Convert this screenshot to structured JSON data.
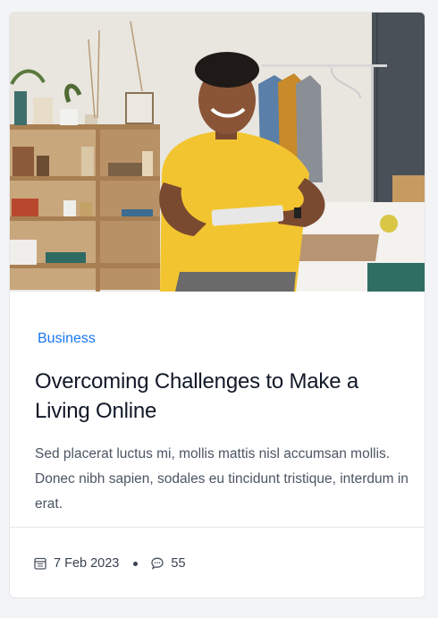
{
  "card": {
    "category": "Business",
    "title": "Overcoming Challenges to Make a Living Online",
    "excerpt": "Sed placerat luctus mi, mollis mattis nisl accumsan mollis. Donec nibh sapien, sodales eu tincidunt tristique, interdum in erat.",
    "date": "7 Feb 2023",
    "comments": "55",
    "icons": {
      "date": "calendar-icon",
      "comments": "comment-icon"
    },
    "colors": {
      "category": "#1877f2",
      "title": "#111827",
      "excerpt": "#4b5563",
      "shirt": "#f2c530"
    }
  }
}
